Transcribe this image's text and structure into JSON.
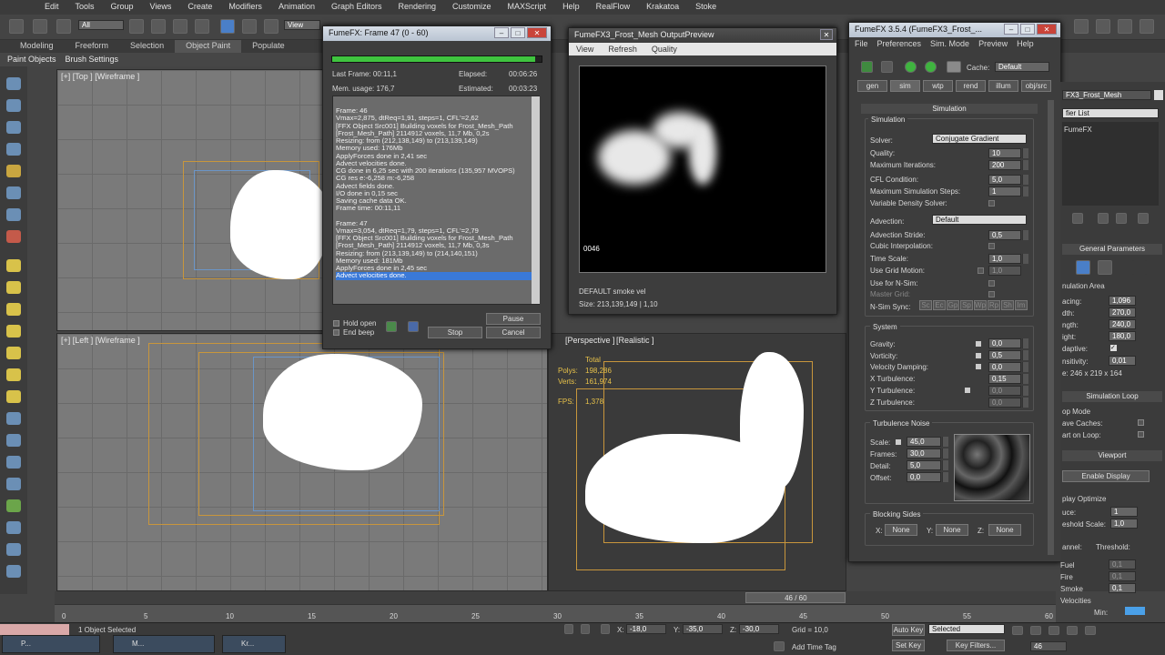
{
  "menubar": [
    "Edit",
    "Tools",
    "Group",
    "Views",
    "Create",
    "Modifiers",
    "Animation",
    "Graph Editors",
    "Rendering",
    "Customize",
    "MAXScript",
    "Help",
    "RealFlow",
    "Krakatoa",
    "Stoke"
  ],
  "toolbar": {
    "filter_value": "All",
    "view_value": "View"
  },
  "ribbon": [
    "Modeling",
    "Freeform",
    "Selection",
    "Object Paint",
    "Populate"
  ],
  "ribbon_active": "Object Paint",
  "subribbon": [
    "Paint Objects",
    "Brush Settings"
  ],
  "viewports": {
    "top": "[+] [Top ] [Wireframe ]",
    "left": "[+] [Left ] [Wireframe ]",
    "persp_a": "[Perspective ]",
    "persp_b": "[Realistic ]"
  },
  "stats": {
    "total": "Total",
    "polys_label": "Polys:",
    "polys": "198,286",
    "verts_label": "Verts:",
    "verts": "161,974",
    "fps_label": "FPS:",
    "fps": "1,378"
  },
  "progress_win": {
    "title": "FumeFX: Frame 47 (0 - 60)",
    "progress": 0.97,
    "last_frame_label": "Last Frame: 00:11,1",
    "elapsed_label": "Elapsed:",
    "elapsed": "00:06:26",
    "mem_label": "Mem. usage: 176,7",
    "estimated_label": "Estimated:",
    "estimated": "00:03:23",
    "log": [
      "Frame: 46",
      "Vmax=2,875, dtReq=1,91, steps=1, CFL'=2,62",
      "[FFX Object Src001] Building voxels for Frost_Mesh_Path",
      "[Frost_Mesh_Path] 2114912 voxels, 11,7 Mb, 0,2s",
      "Resizing: from (212,138,149) to (213,139,149)",
      "Memory used: 176Mb",
      "ApplyForces done in 2,41 sec",
      "Advect velocities done.",
      "CG done in 6,25 sec with 200 iterations (135,957 MVOPS)",
      "CG res e:-6,258 m:-6,258",
      "Advect fields done.",
      "I/O done in 0,15 sec",
      "Saving cache data OK.",
      "Frame time: 00:11,11",
      "",
      "Frame: 47",
      "Vmax=3,054, dtReq=1,79, steps=1, CFL'=2,79",
      "[FFX Object Src001] Building voxels for Frost_Mesh_Path",
      "[Frost_Mesh_Path] 2114912 voxels, 11,7 Mb, 0,3s",
      "Resizing: from (213,139,149) to (214,140,151)",
      "Memory used: 181Mb",
      "ApplyForces done in 2,45 sec",
      "Advect velocities done."
    ],
    "hold_open": "Hold open",
    "end_beep": "End beep",
    "pause": "Pause",
    "stop": "Stop",
    "cancel": "Cancel"
  },
  "preview_win": {
    "title": "FumeFX3_Frost_Mesh OutputPreview",
    "menu": [
      "View",
      "Refresh",
      "Quality"
    ],
    "frame": "0046",
    "channel": "DEFAULT smoke vel",
    "size": "Size: 213,139,149 | 1,10"
  },
  "fumefx_win": {
    "title": "FumeFX 3.5.4 (FumeFX3_Frost_...",
    "menu": [
      "File",
      "Preferences",
      "Sim. Mode",
      "Preview",
      "Help"
    ],
    "cache_label": "Cache:",
    "cache_value": "Default",
    "tabs": [
      "gen",
      "sim",
      "wtp",
      "rend",
      "illum",
      "obj/src"
    ],
    "rollout": "Simulation",
    "sim_group": "Simulation",
    "solver_label": "Solver:",
    "solver": "Conjugate Gradient",
    "quality_label": "Quality:",
    "quality": "10",
    "max_iter_label": "Maximum Iterations:",
    "max_iter": "200",
    "cfl_label": "CFL Condition:",
    "cfl": "5,0",
    "max_steps_label": "Maximum Simulation Steps:",
    "max_steps": "1",
    "vds_label": "Variable Density Solver:",
    "advection_label": "Advection:",
    "advection": "Default",
    "adv_stride_label": "Advection Stride:",
    "adv_stride": "0,5",
    "cubic_label": "Cubic Interpolation:",
    "time_scale_label": "Time Scale:",
    "time_scale": "1,0",
    "grid_motion_label": "Use Grid Motion:",
    "grid_motion": "1,0",
    "nsim_label": "Use for N-Sim:",
    "master_label": "Master Grid:",
    "nsim_sync_label": "N-Sim Sync:",
    "sync_buttons": [
      "Sc",
      "Ec",
      "Gp",
      "Sp",
      "Wp",
      "Rp",
      "Sh",
      "Im"
    ],
    "system_group": "System",
    "gravity_label": "Gravity:",
    "gravity": "0,0",
    "vorticity_label": "Vorticity:",
    "vorticity": "0,5",
    "vel_damp_label": "Velocity Damping:",
    "vel_damp": "0,0",
    "xturb_label": "X Turbulence:",
    "xturb": "0,15",
    "yturb_label": "Y Turbulence:",
    "yturb": "0,0",
    "zturb_label": "Z Turbulence:",
    "zturb": "0,0",
    "noise_group": "Turbulence Noise",
    "scale_label": "Scale:",
    "scale": "45,0",
    "frames_label": "Frames:",
    "frames": "30,0",
    "detail_label": "Detail:",
    "detail": "5,0",
    "offset_label": "Offset:",
    "offset": "0,0",
    "blocking_group": "Blocking Sides",
    "x_label": "X:",
    "y_label": "Y:",
    "z_label": "Z:",
    "none": "None"
  },
  "right_panel": {
    "object_name": "FX3_Frost_Mesh",
    "modifier_list": "fier List",
    "stack_item": "FumeFX",
    "gen_params": "General Parameters",
    "sim_area": "nulation Area",
    "spacing_label": "acing:",
    "spacing": "1,096",
    "width_label": "dth:",
    "width": "270,0",
    "length_label": "ngth:",
    "length": "240,0",
    "height_label": "ight:",
    "height": "180,0",
    "adaptive_label": "daptive:",
    "sensitivity_label": "nsitivity:",
    "sensitivity": "0,01",
    "grid_size": "e: 246 x 219 x 164",
    "sim_loop": "Simulation Loop",
    "loop_mode": "op Mode",
    "wave_caches": "ave Caches:",
    "start_on_loop": "art on Loop:",
    "viewport_head": "Viewport",
    "enable_display": "Enable Display",
    "display_optimize": "play Optimize",
    "reduce_label": "uce:",
    "reduce": "1",
    "threshold_scale_label": "eshold Scale:",
    "threshold_scale": "1,0",
    "channel_label": "annel:",
    "threshold_label": "Threshold:",
    "fuel": "Fuel",
    "fuel_v": "0,1",
    "fire": "Fire",
    "fire_v": "0,1",
    "smoke": "Smoke",
    "smoke_v": "0,1",
    "velocities": "Velocities",
    "min_label": "Min:"
  },
  "timeline": {
    "position": "46 / 60",
    "ticks": [
      "0",
      "5",
      "10",
      "15",
      "20",
      "25",
      "30",
      "35",
      "40",
      "45",
      "50",
      "55",
      "60"
    ],
    "fraction": 0.767
  },
  "status": {
    "selected": "1 Object Selected",
    "x_label": "X:",
    "x": "-18,0",
    "y_label": "Y:",
    "y": "-35,0",
    "z_label": "Z:",
    "z": "-30,0",
    "grid": "Grid = 10,0",
    "add_time_tag": "Add Time Tag",
    "auto_key": "Auto Key",
    "selected_dd": "Selected",
    "set_key": "Set Key",
    "key_filters": "Key Filters...",
    "frame": "46"
  },
  "taskbar": [
    "P...",
    "M...",
    "Kr..."
  ]
}
